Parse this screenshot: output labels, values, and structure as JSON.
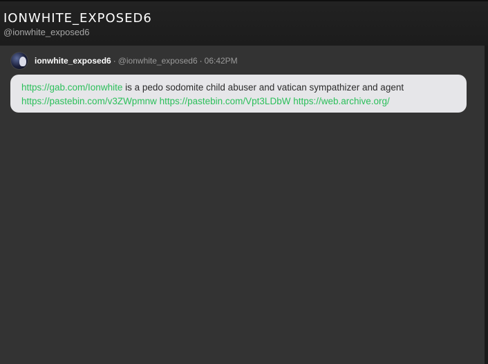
{
  "profile": {
    "display_name": "IONWHITE_EXPOSED6",
    "handle": "@ionwhite_exposed6"
  },
  "post": {
    "author": "ionwhite_exposed6",
    "separator": "·",
    "handle": "@ionwhite_exposed6",
    "time": "06:42PM",
    "link1": "https://gab.com/Ionwhite",
    "text1": " is a pedo sodomite child abuser and vatican sympathizer and agent",
    "link2": "https://pastebin.com/v3ZWpmnw",
    "link3": "https://pastebin.com/Vpt3LDbW",
    "link4": "https://web.archive.org/"
  },
  "colors": {
    "link": "#2bbf5a",
    "feed_bg": "#333333",
    "header_bg": "#1e1e1e",
    "bubble_bg": "#e6e6e9"
  }
}
